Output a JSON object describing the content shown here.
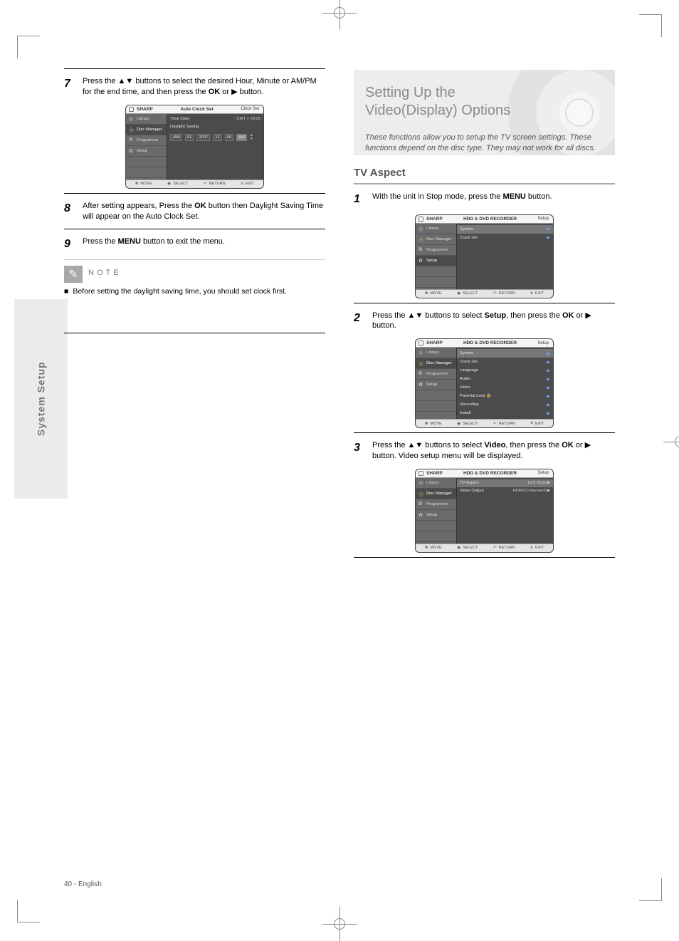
{
  "page_number": "40 - English",
  "sidetab": "System Setup",
  "left": {
    "step7": {
      "num": "7",
      "text_before": "Press the ",
      "buttons": "▲▼",
      "text_mid": " buttons to select the desired Hour, Minute or AM/PM for the end time, and then press the ",
      "ok": "OK",
      "or": " or ",
      "right": "▶",
      "after": " button."
    },
    "osd7": {
      "brand": "SHARP",
      "title": "Auto Clock Set",
      "crumb": "Clock Set",
      "side": [
        "Library",
        "Disc Manager",
        "Programme",
        "Setup"
      ],
      "rows": [
        {
          "lbl": "Time Zone",
          "val": "GMT + 00:00"
        }
      ],
      "daylight_label": "Daylight Saving",
      "time_row": {
        "segments": [
          "JAN",
          "01",
          "2007",
          "12",
          "00"
        ],
        "ampm": "AM"
      },
      "foot": [
        "MOVE",
        "SELECT",
        "RETURN",
        "EXIT"
      ]
    },
    "step8": {
      "num": "8",
      "text_before": "After setting appears, Press the ",
      "ok": "OK",
      "text_after": " button then Daylight Saving Time will appear on the Auto Clock Set."
    },
    "step9": {
      "num": "9",
      "text_before": "Press the ",
      "menu": "MENU",
      "text_after": " button to exit the menu."
    },
    "note_label": "NOTE",
    "note_text": "Before setting the daylight saving time, you should set clock first."
  },
  "right": {
    "banner_title_l1": "Setting Up the",
    "banner_title_l2": "Video(Display) Options",
    "banner_sub": "These functions allow you to setup the TV screen settings. These functions depend on the disc type. They may not work for all discs.",
    "step1": {
      "num": "1",
      "text_before": "With the unit in Stop mode, press the ",
      "menu": "MENU",
      "text_after": " button."
    },
    "osd1": {
      "brand": "SHARP",
      "title": "HDD & DVD RECORDER",
      "crumb": "Setup",
      "side": [
        "Library",
        "Disc Manager",
        "Programme",
        "Setup"
      ],
      "rows": [
        {
          "lbl": "System",
          "val": "▶"
        },
        {
          "lbl": "Clock Set",
          "val": "▶"
        }
      ],
      "foot": [
        "MOVE",
        "SELECT",
        "RETURN",
        "EXIT"
      ]
    },
    "step2": {
      "num": "2",
      "text_before": "Press the ",
      "ud": "▲▼",
      "mid": " buttons to select ",
      "target": "Setup",
      "after_target": ", then press the ",
      "ok": "OK",
      "or": " or ",
      "right": "▶",
      "end": " button."
    },
    "osd2": {
      "brand": "SHARP",
      "title": "HDD & DVD RECORDER",
      "crumb": "Setup",
      "side": [
        "Library",
        "Disc Manager",
        "Programme",
        "Setup"
      ],
      "rows": [
        {
          "lbl": "System",
          "val": "▶",
          "hi": true
        },
        {
          "lbl": "Clock Set",
          "val": "▶"
        },
        {
          "lbl": "Language",
          "val": "▶"
        },
        {
          "lbl": "Audio",
          "val": "▶"
        },
        {
          "lbl": "Video",
          "val": "▶"
        },
        {
          "lbl": "Parental Lock",
          "val": "▶",
          "lock": true
        },
        {
          "lbl": "Recording",
          "val": "▶"
        },
        {
          "lbl": "Install",
          "val": "▶"
        }
      ],
      "foot": [
        "MOVE",
        "SELECT",
        "RETURN",
        "EXIT"
      ]
    },
    "step3": {
      "num": "3",
      "text_before": "Press the ",
      "ud": "▲▼",
      "mid": " buttons to select ",
      "target": "Video",
      "after_target": ", then press the ",
      "ok": "OK",
      "or": " or ",
      "right": "▶",
      "end": " button. Video setup menu will be displayed."
    },
    "osd3": {
      "brand": "SHARP",
      "title": "HDD & DVD RECORDER",
      "crumb": "Setup",
      "side": [
        "Library",
        "Disc Manager",
        "Programme",
        "Setup"
      ],
      "rows": [
        {
          "lbl": "TV Aspect",
          "val": "16:9 Wide ▶",
          "hi": true
        },
        {
          "lbl": "Video Output",
          "val": "HDMI/Component ▶"
        }
      ],
      "foot": [
        "MOVE",
        "SELECT",
        "RETURN",
        "EXIT"
      ]
    },
    "section_title": "TV Aspect"
  },
  "icons": {
    "move": "✥",
    "select": "◉",
    "return": "↶",
    "exit": "⦻",
    "pencil": "✎",
    "lock": "🔒"
  }
}
